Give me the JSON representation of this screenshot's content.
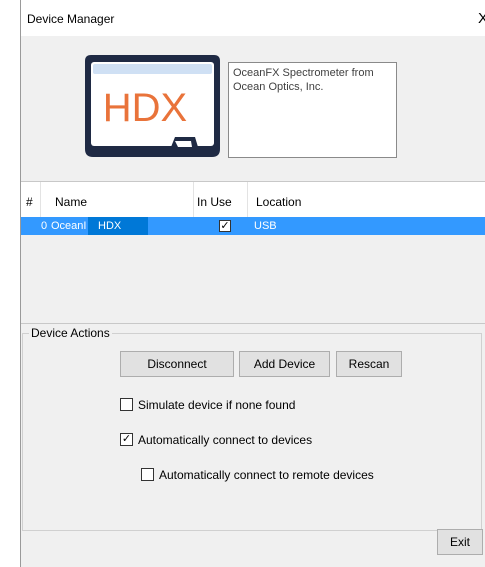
{
  "window": {
    "title": "Device Manager",
    "close_glyph": "X"
  },
  "logo": {
    "text": "HDX"
  },
  "description": "OceanFX Spectrometer from Ocean Optics, Inc.",
  "table": {
    "headers": {
      "index": "#",
      "name": "Name",
      "in_use": "In Use",
      "location": "Location"
    },
    "rows": [
      {
        "index": "0",
        "name": "OceanI",
        "tag": "HDX",
        "in_use": true,
        "location": "USB"
      }
    ]
  },
  "device_actions": {
    "label": "Device Actions",
    "buttons": {
      "disconnect": "Disconnect",
      "add_device": "Add Device",
      "rescan": "Rescan"
    },
    "options": {
      "simulate": {
        "label": "Simulate device if none found",
        "checked": false
      },
      "auto_connect": {
        "label": "Automatically connect to devices",
        "checked": true
      },
      "auto_connect_remote": {
        "label": "Automatically connect to remote devices",
        "checked": false
      }
    }
  },
  "exit_label": "Exit",
  "colors": {
    "selection": "#3399ff",
    "logo_orange": "#e9733a",
    "logo_navy": "#1f2a44"
  },
  "icons": {
    "close": "close-icon",
    "logo": "hdx-logo-icon",
    "check": "checkmark-icon"
  }
}
